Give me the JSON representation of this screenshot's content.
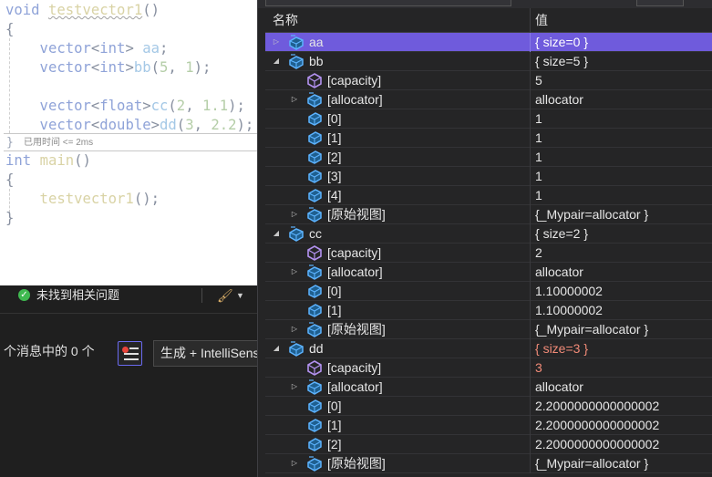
{
  "editor": {
    "lines": [
      [
        {
          "t": "void ",
          "c": "kw"
        },
        {
          "t": "testvector1",
          "c": "fn sq"
        },
        {
          "t": "()",
          "c": "pun"
        }
      ],
      [
        {
          "t": "{",
          "c": "pun"
        }
      ],
      [
        {
          "t": "    vector",
          "c": "type"
        },
        {
          "t": "<",
          "c": "pun"
        },
        {
          "t": "int",
          "c": "kw"
        },
        {
          "t": "> ",
          "c": "pun"
        },
        {
          "t": "aa",
          "c": "var"
        },
        {
          "t": ";",
          "c": "pun"
        }
      ],
      [
        {
          "t": "    vector",
          "c": "type"
        },
        {
          "t": "<",
          "c": "pun"
        },
        {
          "t": "int",
          "c": "kw"
        },
        {
          "t": ">",
          "c": "pun"
        },
        {
          "t": "bb",
          "c": "var"
        },
        {
          "t": "(",
          "c": "pun"
        },
        {
          "t": "5",
          "c": "num"
        },
        {
          "t": ", ",
          "c": "pun"
        },
        {
          "t": "1",
          "c": "num"
        },
        {
          "t": ");",
          "c": "pun"
        }
      ],
      [
        {
          "t": "",
          "c": "pun"
        }
      ],
      [
        {
          "t": "    vector",
          "c": "type"
        },
        {
          "t": "<",
          "c": "pun"
        },
        {
          "t": "float",
          "c": "kw"
        },
        {
          "t": ">",
          "c": "pun"
        },
        {
          "t": "cc",
          "c": "var"
        },
        {
          "t": "(",
          "c": "pun"
        },
        {
          "t": "2",
          "c": "num"
        },
        {
          "t": ", ",
          "c": "pun"
        },
        {
          "t": "1.1",
          "c": "num"
        },
        {
          "t": ");",
          "c": "pun"
        }
      ],
      [
        {
          "t": "    vector",
          "c": "type"
        },
        {
          "t": "<",
          "c": "pun"
        },
        {
          "t": "double",
          "c": "kw"
        },
        {
          "t": ">",
          "c": "pun"
        },
        {
          "t": "dd",
          "c": "var"
        },
        {
          "t": "(",
          "c": "pun"
        },
        {
          "t": "3",
          "c": "num"
        },
        {
          "t": ", ",
          "c": "pun"
        },
        {
          "t": "2.2",
          "c": "num"
        },
        {
          "t": ");",
          "c": "pun"
        }
      ]
    ],
    "perf_tip": "已用时间 <= 2ms",
    "closing_brace": "}",
    "lines_after": [
      [
        {
          "t": "int ",
          "c": "kw"
        },
        {
          "t": "main",
          "c": "fn"
        },
        {
          "t": "()",
          "c": "pun"
        }
      ],
      [
        {
          "t": "{",
          "c": "pun"
        }
      ],
      [
        {
          "t": "    testvector1",
          "c": "fn"
        },
        {
          "t": "();",
          "c": "pun"
        }
      ],
      [
        {
          "t": "}",
          "c": "pun"
        }
      ]
    ]
  },
  "status": {
    "issues_text": "未找到相关问题"
  },
  "error_list": {
    "count_text": "个消息中的 0 个",
    "scope_combo": "生成 + IntelliSense"
  },
  "watch": {
    "columns": {
      "name": "名称",
      "value": "值"
    },
    "rows": [
      {
        "level": 0,
        "exp": "collapsed",
        "icon": "variable",
        "name": "aa",
        "value": "{ size=0 }",
        "selected": true
      },
      {
        "level": 0,
        "exp": "expanded",
        "icon": "variable",
        "name": "bb",
        "value": "{ size=5 }"
      },
      {
        "level": 1,
        "exp": "none",
        "icon": "property",
        "name": "[capacity]",
        "value": "5"
      },
      {
        "level": 1,
        "exp": "collapsed",
        "icon": "variable",
        "name": "[allocator]",
        "value": "allocator"
      },
      {
        "level": 1,
        "exp": "none",
        "icon": "field",
        "name": "[0]",
        "value": "1"
      },
      {
        "level": 1,
        "exp": "none",
        "icon": "field",
        "name": "[1]",
        "value": "1"
      },
      {
        "level": 1,
        "exp": "none",
        "icon": "field",
        "name": "[2]",
        "value": "1"
      },
      {
        "level": 1,
        "exp": "none",
        "icon": "field",
        "name": "[3]",
        "value": "1"
      },
      {
        "level": 1,
        "exp": "none",
        "icon": "field",
        "name": "[4]",
        "value": "1"
      },
      {
        "level": 1,
        "exp": "collapsed",
        "icon": "variable",
        "name": "[原始视图]",
        "value": "{_Mypair=allocator }"
      },
      {
        "level": 0,
        "exp": "expanded",
        "icon": "variable",
        "name": "cc",
        "value": "{ size=2 }"
      },
      {
        "level": 1,
        "exp": "none",
        "icon": "property",
        "name": "[capacity]",
        "value": "2"
      },
      {
        "level": 1,
        "exp": "collapsed",
        "icon": "variable",
        "name": "[allocator]",
        "value": "allocator"
      },
      {
        "level": 1,
        "exp": "none",
        "icon": "field",
        "name": "[0]",
        "value": "1.10000002"
      },
      {
        "level": 1,
        "exp": "none",
        "icon": "field",
        "name": "[1]",
        "value": "1.10000002"
      },
      {
        "level": 1,
        "exp": "collapsed",
        "icon": "variable",
        "name": "[原始视图]",
        "value": "{_Mypair=allocator }"
      },
      {
        "level": 0,
        "exp": "expanded",
        "icon": "variable",
        "name": "dd",
        "value": "{ size=3 }",
        "changed": true
      },
      {
        "level": 1,
        "exp": "none",
        "icon": "property",
        "name": "[capacity]",
        "value": "3",
        "changed": true
      },
      {
        "level": 1,
        "exp": "collapsed",
        "icon": "variable",
        "name": "[allocator]",
        "value": "allocator"
      },
      {
        "level": 1,
        "exp": "none",
        "icon": "field",
        "name": "[0]",
        "value": "2.2000000000000002"
      },
      {
        "level": 1,
        "exp": "none",
        "icon": "field",
        "name": "[1]",
        "value": "2.2000000000000002"
      },
      {
        "level": 1,
        "exp": "none",
        "icon": "field",
        "name": "[2]",
        "value": "2.2000000000000002"
      },
      {
        "level": 1,
        "exp": "collapsed",
        "icon": "variable",
        "name": "[原始视图]",
        "value": "{_Mypair=allocator }"
      }
    ]
  },
  "colors": {
    "selection": "#6f5bdc",
    "changed_value": "#f28b78",
    "ok": "#3fb950"
  }
}
